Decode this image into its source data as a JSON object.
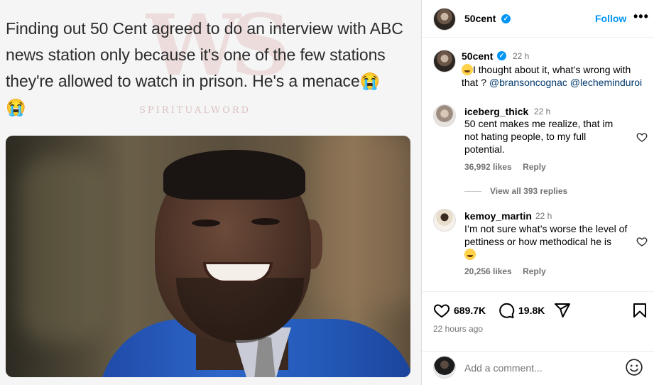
{
  "post_image": {
    "tweet_text": "Finding out 50 Cent agreed to do an interview with ABC news station only because it's one of the few stations they're allowed to watch in prison. He's a menace😭 😭",
    "watermark_logo": "WS",
    "watermark_sub": "SPIRITUALWORD"
  },
  "header": {
    "username": "50cent",
    "follow_label": "Follow",
    "more_label": "•••"
  },
  "caption": {
    "username": "50cent",
    "time": "22 h",
    "text": "I thought about it, what’s wrong with that ?",
    "mention_1": "@bransoncognac",
    "mention_2": "@lecheminduroi"
  },
  "comments": [
    {
      "username": "iceberg_thick",
      "time": "22 h",
      "text": "50 cent makes me realize, that im not hating people, to my full potential.",
      "likes": "36,992 likes",
      "reply_label": "Reply",
      "view_replies": "View all 393 replies"
    },
    {
      "username": "kemoy_martin",
      "time": "22 h",
      "text": "I’m not sure what’s worse the level of pettiness or how methodical he is",
      "likes": "20,256 likes",
      "reply_label": "Reply"
    }
  ],
  "actions": {
    "like_count": "689.7K",
    "comment_count": "19.8K",
    "post_time": "22 hours ago"
  },
  "add_comment": {
    "placeholder": "Add a comment..."
  },
  "icons": [
    "verified-icon",
    "more-icon",
    "heart-icon",
    "comment-icon",
    "share-icon",
    "bookmark-icon",
    "emoji-icon"
  ],
  "colors": {
    "accent": "#0095f6",
    "mention": "#00376b",
    "muted": "#737373"
  }
}
